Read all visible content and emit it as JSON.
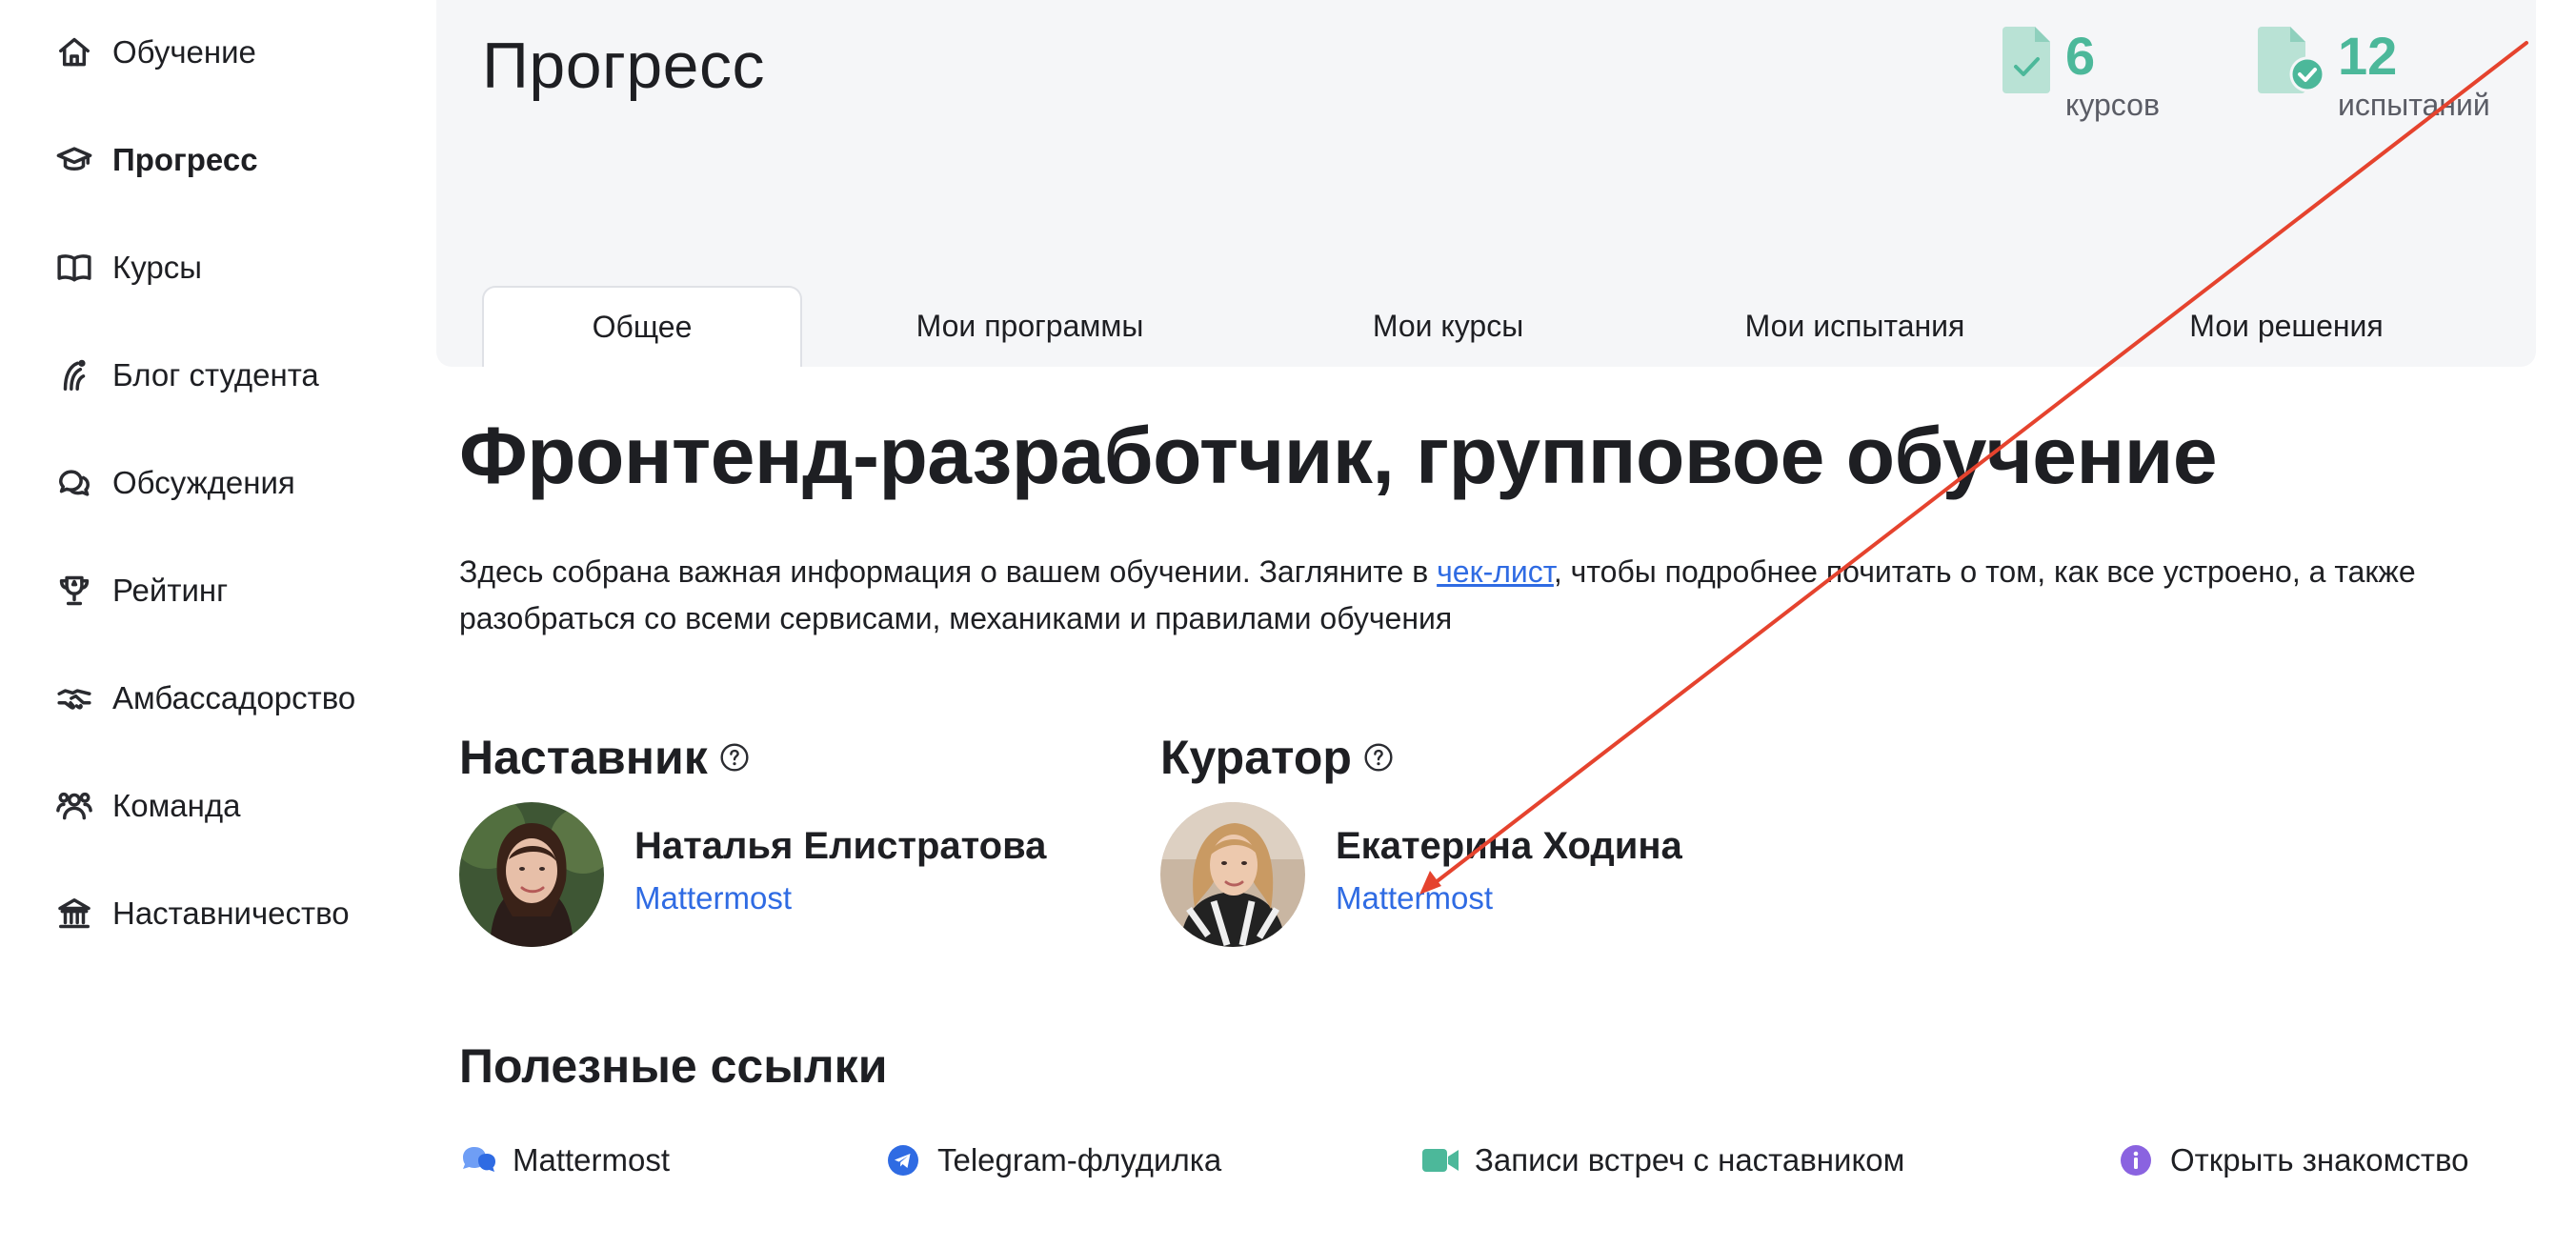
{
  "sidebar": {
    "items": [
      {
        "label": "Обучение",
        "icon": "home-icon",
        "active": false
      },
      {
        "label": "Прогресс",
        "icon": "graduation-cap-icon",
        "active": true
      },
      {
        "label": "Курсы",
        "icon": "book-icon",
        "active": false
      },
      {
        "label": "Блог студента",
        "icon": "blog-icon",
        "active": false
      },
      {
        "label": "Обсуждения",
        "icon": "chat-bubbles-icon",
        "active": false
      },
      {
        "label": "Рейтинг",
        "icon": "trophy-icon",
        "active": false
      },
      {
        "label": "Амбассадорство",
        "icon": "handshake-icon",
        "active": false
      },
      {
        "label": "Команда",
        "icon": "team-icon",
        "active": false
      },
      {
        "label": "Наставничество",
        "icon": "institution-icon",
        "active": false
      }
    ]
  },
  "header": {
    "title": "Прогресс",
    "stats": [
      {
        "value": "6",
        "caption": "курсов",
        "icon": "document-check-icon"
      },
      {
        "value": "12",
        "caption": "испытаний",
        "icon": "document-badge-icon"
      }
    ],
    "tabs": [
      {
        "label": "Общее",
        "active": true
      },
      {
        "label": "Мои программы",
        "active": false
      },
      {
        "label": "Мои курсы",
        "active": false
      },
      {
        "label": "Мои испытания",
        "active": false
      },
      {
        "label": "Мои решения",
        "active": false
      }
    ]
  },
  "main": {
    "title": "Фронтенд-разработчик, групповое обучение",
    "intro_before": "Здесь собрана важная информация о вашем обучении. Загляните в ",
    "intro_link": "чек-лист",
    "intro_after": ", чтобы подробнее почитать о том, как все устроено, а также разобраться со всеми сервисами, механиками и правилами обучения",
    "mentor": {
      "heading": "Наставник",
      "name": "Наталья Елистратова",
      "link": "Mattermost"
    },
    "curator": {
      "heading": "Куратор",
      "name": "Екатерина Ходина",
      "link": "Mattermost"
    },
    "useful_links": {
      "title": "Полезные ссылки",
      "items": [
        {
          "label": "Mattermost",
          "icon": "mattermost-icon"
        },
        {
          "label": "Telegram-флудилка",
          "icon": "telegram-icon"
        },
        {
          "label": "Записи встреч с наставником",
          "icon": "video-camera-icon"
        },
        {
          "label": "Открыть знакомство",
          "icon": "info-icon"
        }
      ]
    }
  },
  "colors": {
    "accent_green": "#4cb89a",
    "link_blue": "#2f6be3",
    "annotation_red": "#e5432e",
    "panel_bg": "#f5f6f8"
  }
}
